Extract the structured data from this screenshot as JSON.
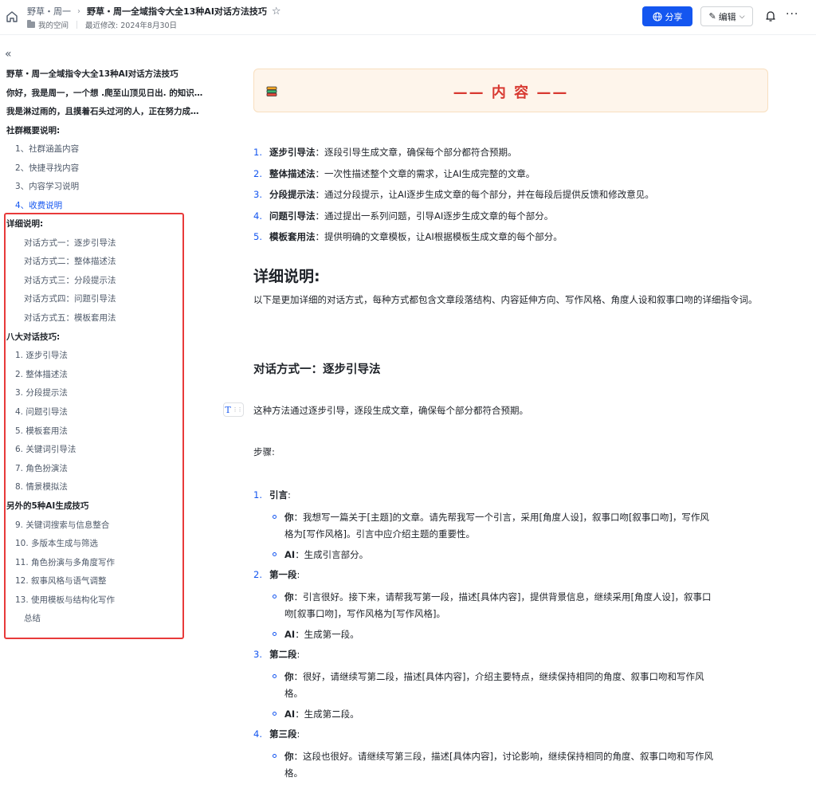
{
  "header": {
    "breadcrumb_parent": "野草・周一",
    "breadcrumb_sep": "›",
    "doc_title": "野草・周一全域指令大全13种AI对话方法技巧",
    "space": "我的空间",
    "last_modified": "最近修改: 2024年8月30日",
    "share_label": "分享",
    "edit_label": "编辑"
  },
  "sidebar": {
    "items": [
      {
        "text": "野草・周一全域指令大全13种AI对话方法技巧",
        "level": "h1"
      },
      {
        "text": "你好，我是周一，一个想 .爬至山顶见日出. 的知识…",
        "level": "h1"
      },
      {
        "text": "我是淋过雨的，且摸着石头过河的人，正在努力成…",
        "level": "h1"
      },
      {
        "text": "社群概要说明:",
        "level": "h1"
      },
      {
        "text": "1、社群涵盖内容",
        "level": "h2"
      },
      {
        "text": "2、快捷寻找内容",
        "level": "h2"
      },
      {
        "text": "3、内容学习说明",
        "level": "h2"
      },
      {
        "text": "4、收费说明",
        "level": "h2",
        "active": true
      },
      {
        "text": "详细说明:",
        "level": "h1"
      },
      {
        "text": "对话方式一：逐步引导法",
        "level": "h3"
      },
      {
        "text": "对话方式二：整体描述法",
        "level": "h3"
      },
      {
        "text": "对话方式三：分段提示法",
        "level": "h3"
      },
      {
        "text": "对话方式四：问题引导法",
        "level": "h3"
      },
      {
        "text": "对话方式五：模板套用法",
        "level": "h3"
      },
      {
        "text": "八大对话技巧:",
        "level": "h1"
      },
      {
        "text": "1. 逐步引导法",
        "level": "h2"
      },
      {
        "text": "2. 整体描述法",
        "level": "h2"
      },
      {
        "text": "3. 分段提示法",
        "level": "h2"
      },
      {
        "text": "4. 问题引导法",
        "level": "h2"
      },
      {
        "text": "5. 模板套用法",
        "level": "h2"
      },
      {
        "text": "6. 关键词引导法",
        "level": "h2"
      },
      {
        "text": "7. 角色扮演法",
        "level": "h2"
      },
      {
        "text": "8. 情景模拟法",
        "level": "h2"
      },
      {
        "text": "另外的5种AI生成技巧",
        "level": "h1"
      },
      {
        "text": "9. 关键词搜索与信息整合",
        "level": "h2"
      },
      {
        "text": "10. 多版本生成与筛选",
        "level": "h2"
      },
      {
        "text": "11. 角色扮演与多角度写作",
        "level": "h2"
      },
      {
        "text": "12. 叙事风格与语气调整",
        "level": "h2"
      },
      {
        "text": "13. 使用模板与结构化写作",
        "level": "h2"
      },
      {
        "text": "总结",
        "level": "h2b"
      }
    ]
  },
  "content": {
    "callout_title": "—— 内 容 ——",
    "methods": [
      {
        "num": "1.",
        "name": "逐步引导法",
        "desc": "：逐段引导生成文章，确保每个部分都符合预期。"
      },
      {
        "num": "2.",
        "name": "整体描述法",
        "desc": "：一次性描述整个文章的需求，让AI生成完整的文章。"
      },
      {
        "num": "3.",
        "name": "分段提示法",
        "desc": "：通过分段提示，让AI逐步生成文章的每个部分，并在每段后提供反馈和修改意见。"
      },
      {
        "num": "4.",
        "name": "问题引导法",
        "desc": "：通过提出一系列问题，引导AI逐步生成文章的每个部分。"
      },
      {
        "num": "5.",
        "name": "模板套用法",
        "desc": "：提供明确的文章模板，让AI根据模板生成文章的每个部分。"
      }
    ],
    "section_heading": "详细说明:",
    "section_intro": "以下是更加详细的对话方式，每种方式都包含文章段落结构、内容延伸方向、写作风格、角度人设和叙事口吻的详细指令词。",
    "sub_heading": "对话方式一：逐步引导法",
    "sub_intro": "这种方法通过逐步引导，逐段生成文章，确保每个部分都符合预期。",
    "steps_label": "步骤:",
    "steps": [
      {
        "num": "1.",
        "title": "引言",
        "colon": ":",
        "you_label": "你",
        "you_text_1": "：我想写一篇关于[主题]的文章。请先帮我写一个引言，采用[角度人设]，叙事口吻[叙事口吻]，写作风",
        "you_text_2": "格为[写作风格]。引言中应介绍主题的重要性。",
        "ai_label": "AI",
        "ai_text": "：生成引言部分。"
      },
      {
        "num": "2.",
        "title": "第一段",
        "colon": ":",
        "you_label": "你",
        "you_text_1": "：引言很好。接下来，请帮我写第一段，描述[具体内容]，提供背景信息，继续采用[角度人设]，叙事口",
        "you_text_2": "吻[叙事口吻]，写作风格为[写作风格]。",
        "ai_label": "AI",
        "ai_text": "：生成第一段。"
      },
      {
        "num": "3.",
        "title": "第二段",
        "colon": ":",
        "you_label": "你",
        "you_text_1": "：很好，请继续写第二段，描述[具体内容]，介绍主要特点，继续保持相同的角度、叙事口吻和写作风",
        "you_text_2": "格。",
        "ai_label": "AI",
        "ai_text": "：生成第二段。"
      },
      {
        "num": "4.",
        "title": "第三段",
        "colon": ":",
        "you_label": "你",
        "you_text_1": "：这段也很好。请继续写第三段，描述[具体内容]，讨论影响，继续保持相同的角度、叙事口吻和写作风",
        "you_text_2": "格。"
      }
    ]
  },
  "colors": {
    "accent": "#1456f0",
    "highlight_red": "#e83a3a",
    "callout_bg": "#fef5eb",
    "callout_title": "#d83931"
  }
}
